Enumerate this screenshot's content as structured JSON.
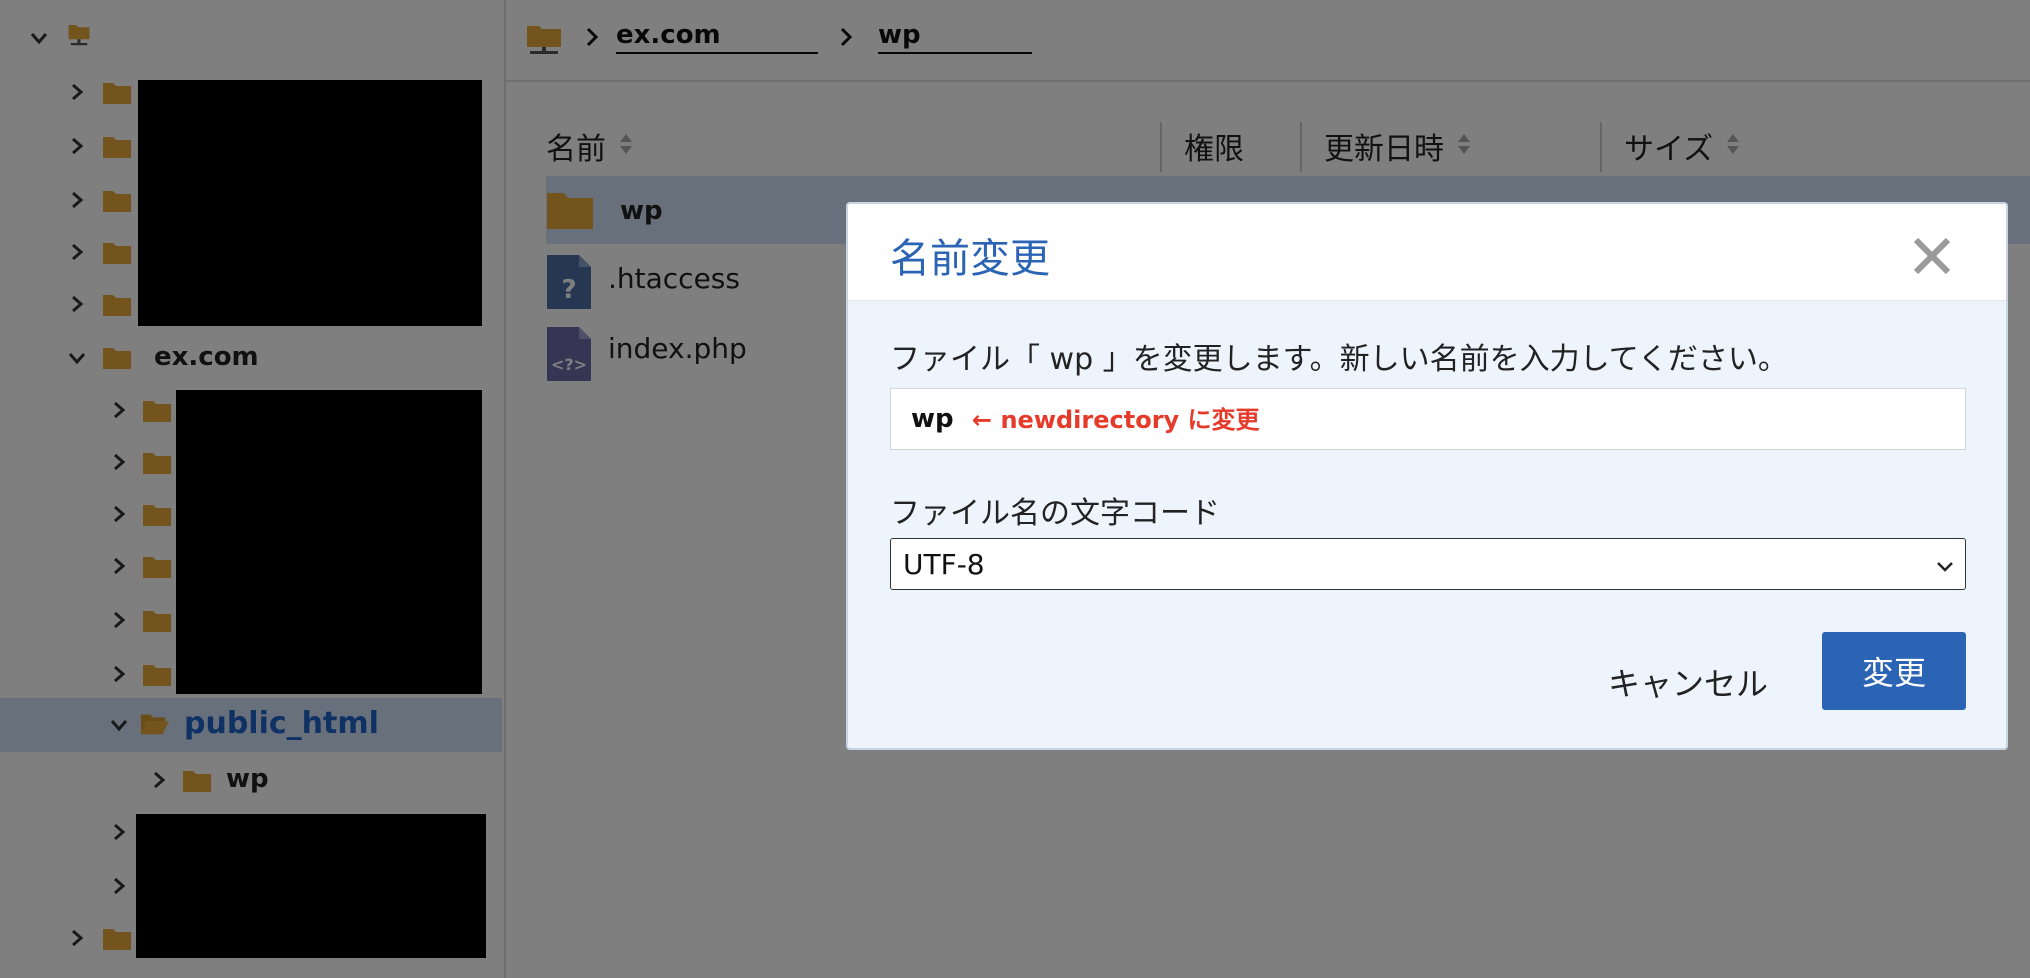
{
  "sidebar": {
    "root_label": "",
    "domain_folder": "ex.com",
    "selected_folder": "public_html",
    "child_folder": "wp"
  },
  "breadcrumb": {
    "item1": "ex.com",
    "item2": "wp"
  },
  "file_list": {
    "columns": {
      "name": "名前",
      "permission": "権限",
      "modified": "更新日時",
      "size": "サイズ"
    },
    "rows": [
      {
        "name": "wp",
        "type": "folder"
      },
      {
        "name": ".htaccess",
        "type": "unknown"
      },
      {
        "name": "index.php",
        "type": "php"
      }
    ]
  },
  "dialog": {
    "title": "名前変更",
    "message": "ファイル「 wp 」を変更します。新しい名前を入力してください。",
    "name_value": "wp",
    "annotation": "← newdirectory に変更",
    "encoding_label": "ファイル名の文字コード",
    "encoding_value": "UTF-8",
    "cancel_label": "キャンセル",
    "ok_label": "変更"
  },
  "colors": {
    "accent": "#2b63b5",
    "folder": "#e6a93a",
    "annotation": "#e63a2a"
  }
}
